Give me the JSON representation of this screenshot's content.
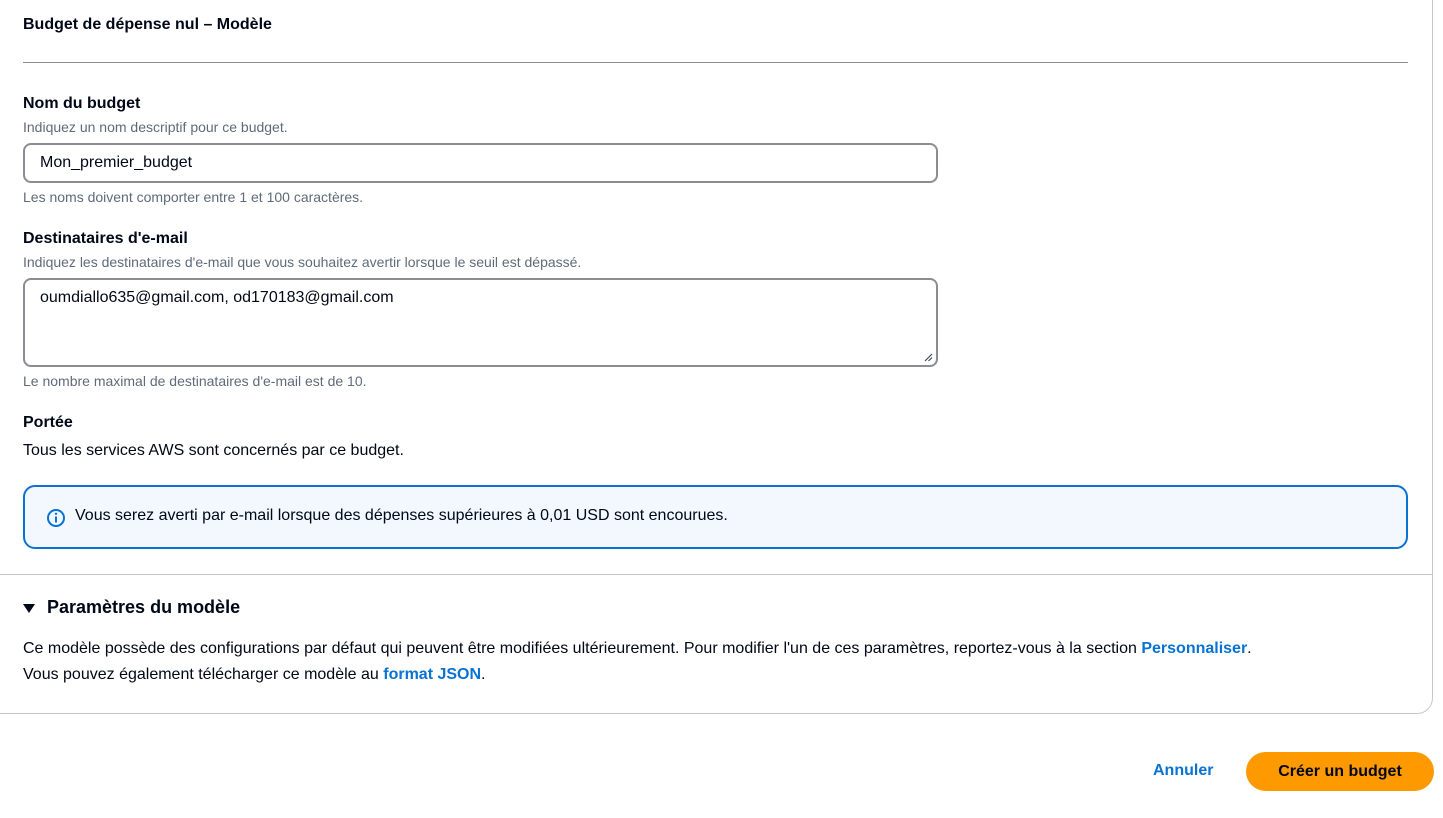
{
  "section": {
    "title": "Budget de dépense nul – Modèle"
  },
  "budget_name": {
    "label": "Nom du budget",
    "description": "Indiquez un nom descriptif pour ce budget.",
    "value": "Mon_premier_budget",
    "constraint": "Les noms doivent comporter entre 1 et 100 caractères."
  },
  "email_recipients": {
    "label": "Destinataires d'e-mail",
    "description": "Indiquez les destinataires d'e-mail que vous souhaitez avertir lorsque le seuil est dépassé.",
    "value": "oumdiallo635@gmail.com, od170183@gmail.com",
    "constraint": "Le nombre maximal de destinataires d'e-mail est de 10."
  },
  "scope": {
    "label": "Portée",
    "text": "Tous les services AWS sont concernés par ce budget."
  },
  "alert": {
    "icon": "info-icon",
    "text": "Vous serez averti par e-mail lorsque des dépenses supérieures à 0,01 USD sont encourues."
  },
  "template_settings": {
    "title": "Paramètres du modèle",
    "expanded": true,
    "line1_text": "Ce modèle possède des configurations par défaut qui peuvent être modifiées ultérieurement. Pour modifier l'un de ces paramètres, reportez-vous à la section ",
    "line1_link": "Personnaliser",
    "line1_end": ".",
    "line2_text": "Vous pouvez également télécharger ce modèle au ",
    "line2_link": "format JSON",
    "line2_end": "."
  },
  "actions": {
    "cancel_label": "Annuler",
    "create_label": "Créer un budget"
  },
  "colors": {
    "accent": "#0972d3",
    "primary_button": "#ff9900",
    "info_background": "#f2f8fd"
  }
}
